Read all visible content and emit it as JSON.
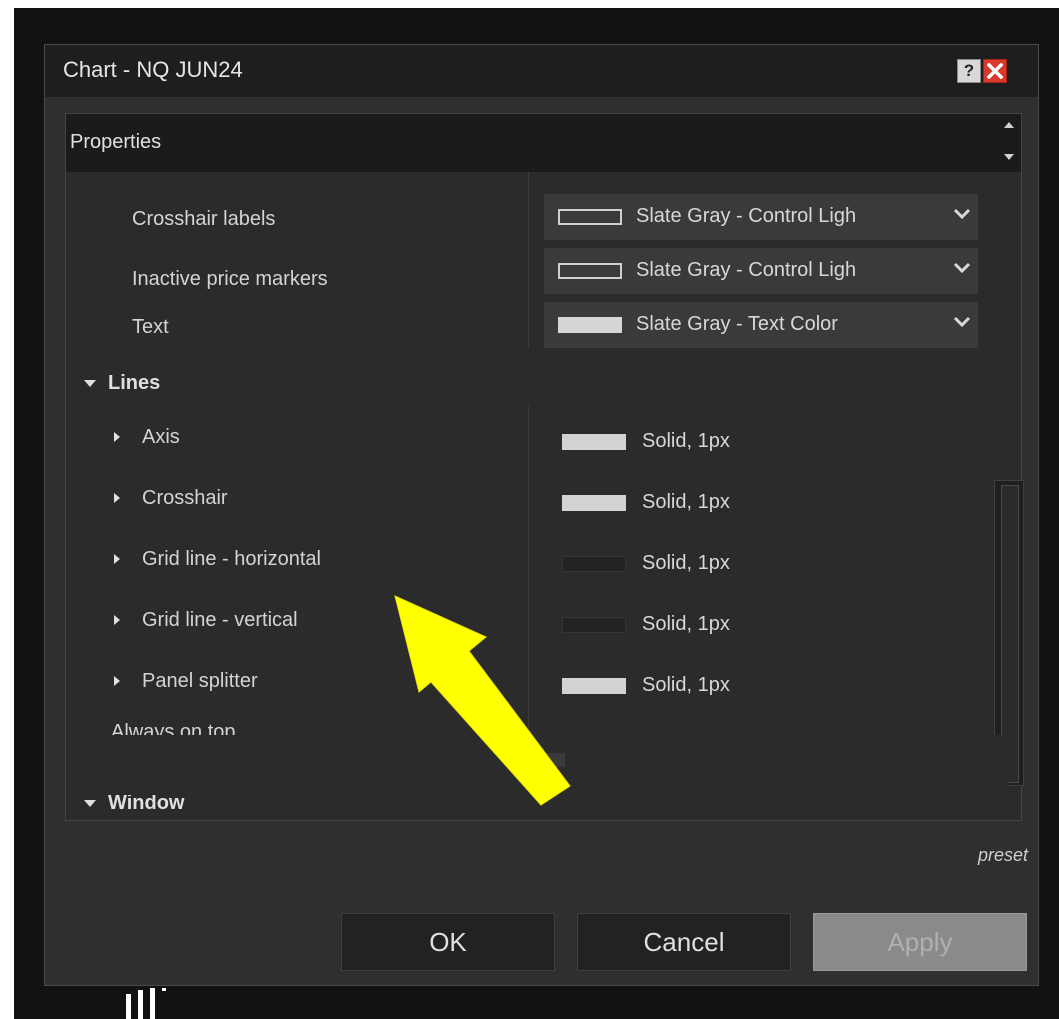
{
  "window": {
    "title": "Chart - NQ JUN24",
    "help_label": "?"
  },
  "panel": {
    "header": "Properties"
  },
  "properties": {
    "color_rows": [
      {
        "label": "Crosshair labels",
        "value": "Slate Gray - Control Ligh",
        "swatch": "outline"
      },
      {
        "label": "Inactive price markers",
        "value": "Slate Gray - Control Ligh",
        "swatch": "outline"
      },
      {
        "label": "Text",
        "value": "Slate Gray - Text Color",
        "swatch": "fill"
      }
    ],
    "lines_category": "Lines",
    "line_rows": [
      {
        "label": "Axis",
        "value": "Solid, 1px",
        "swatch_color": "#d2d2d2"
      },
      {
        "label": "Crosshair",
        "value": "Solid, 1px",
        "swatch_color": "#d2d2d2"
      },
      {
        "label": "Grid line - horizontal",
        "value": "Solid, 1px",
        "swatch_color": "#232323"
      },
      {
        "label": "Grid line - vertical",
        "value": "Solid, 1px",
        "swatch_color": "#232323"
      },
      {
        "label": "Panel splitter",
        "value": "Solid, 1px",
        "swatch_color": "#d2d2d2"
      }
    ],
    "window_category": "Window",
    "partial_row": "Always on top"
  },
  "footer": {
    "preset": "preset",
    "ok": "OK",
    "cancel": "Cancel",
    "apply": "Apply"
  },
  "annotation": {
    "arrow_color": "#ffff00"
  }
}
